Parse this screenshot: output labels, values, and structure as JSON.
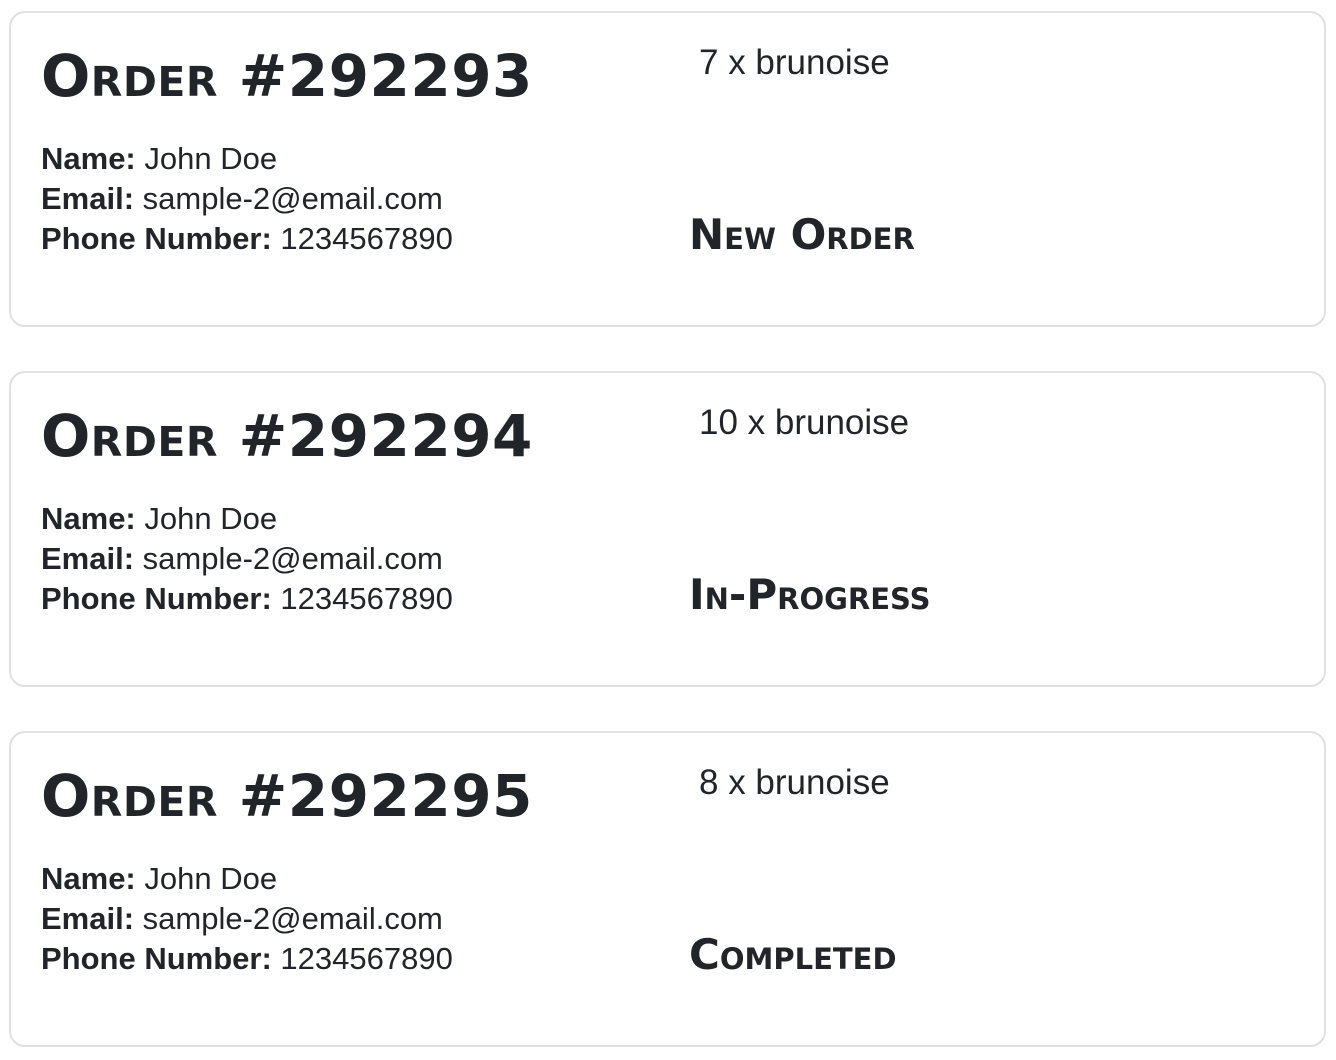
{
  "labels": {
    "name": "Name:",
    "email": "Email:",
    "phone": "Phone Number:"
  },
  "orders": [
    {
      "title": "Order #292293",
      "name": "John Doe",
      "email": "sample-2@email.com",
      "phone": "1234567890",
      "items": "7 x brunoise",
      "status": "New Order"
    },
    {
      "title": "Order #292294",
      "name": "John Doe",
      "email": "sample-2@email.com",
      "phone": "1234567890",
      "items": "10 x brunoise",
      "status": "In-Progress"
    },
    {
      "title": "Order #292295",
      "name": "John Doe",
      "email": "sample-2@email.com",
      "phone": "1234567890",
      "items": "8 x brunoise",
      "status": "Completed"
    }
  ]
}
